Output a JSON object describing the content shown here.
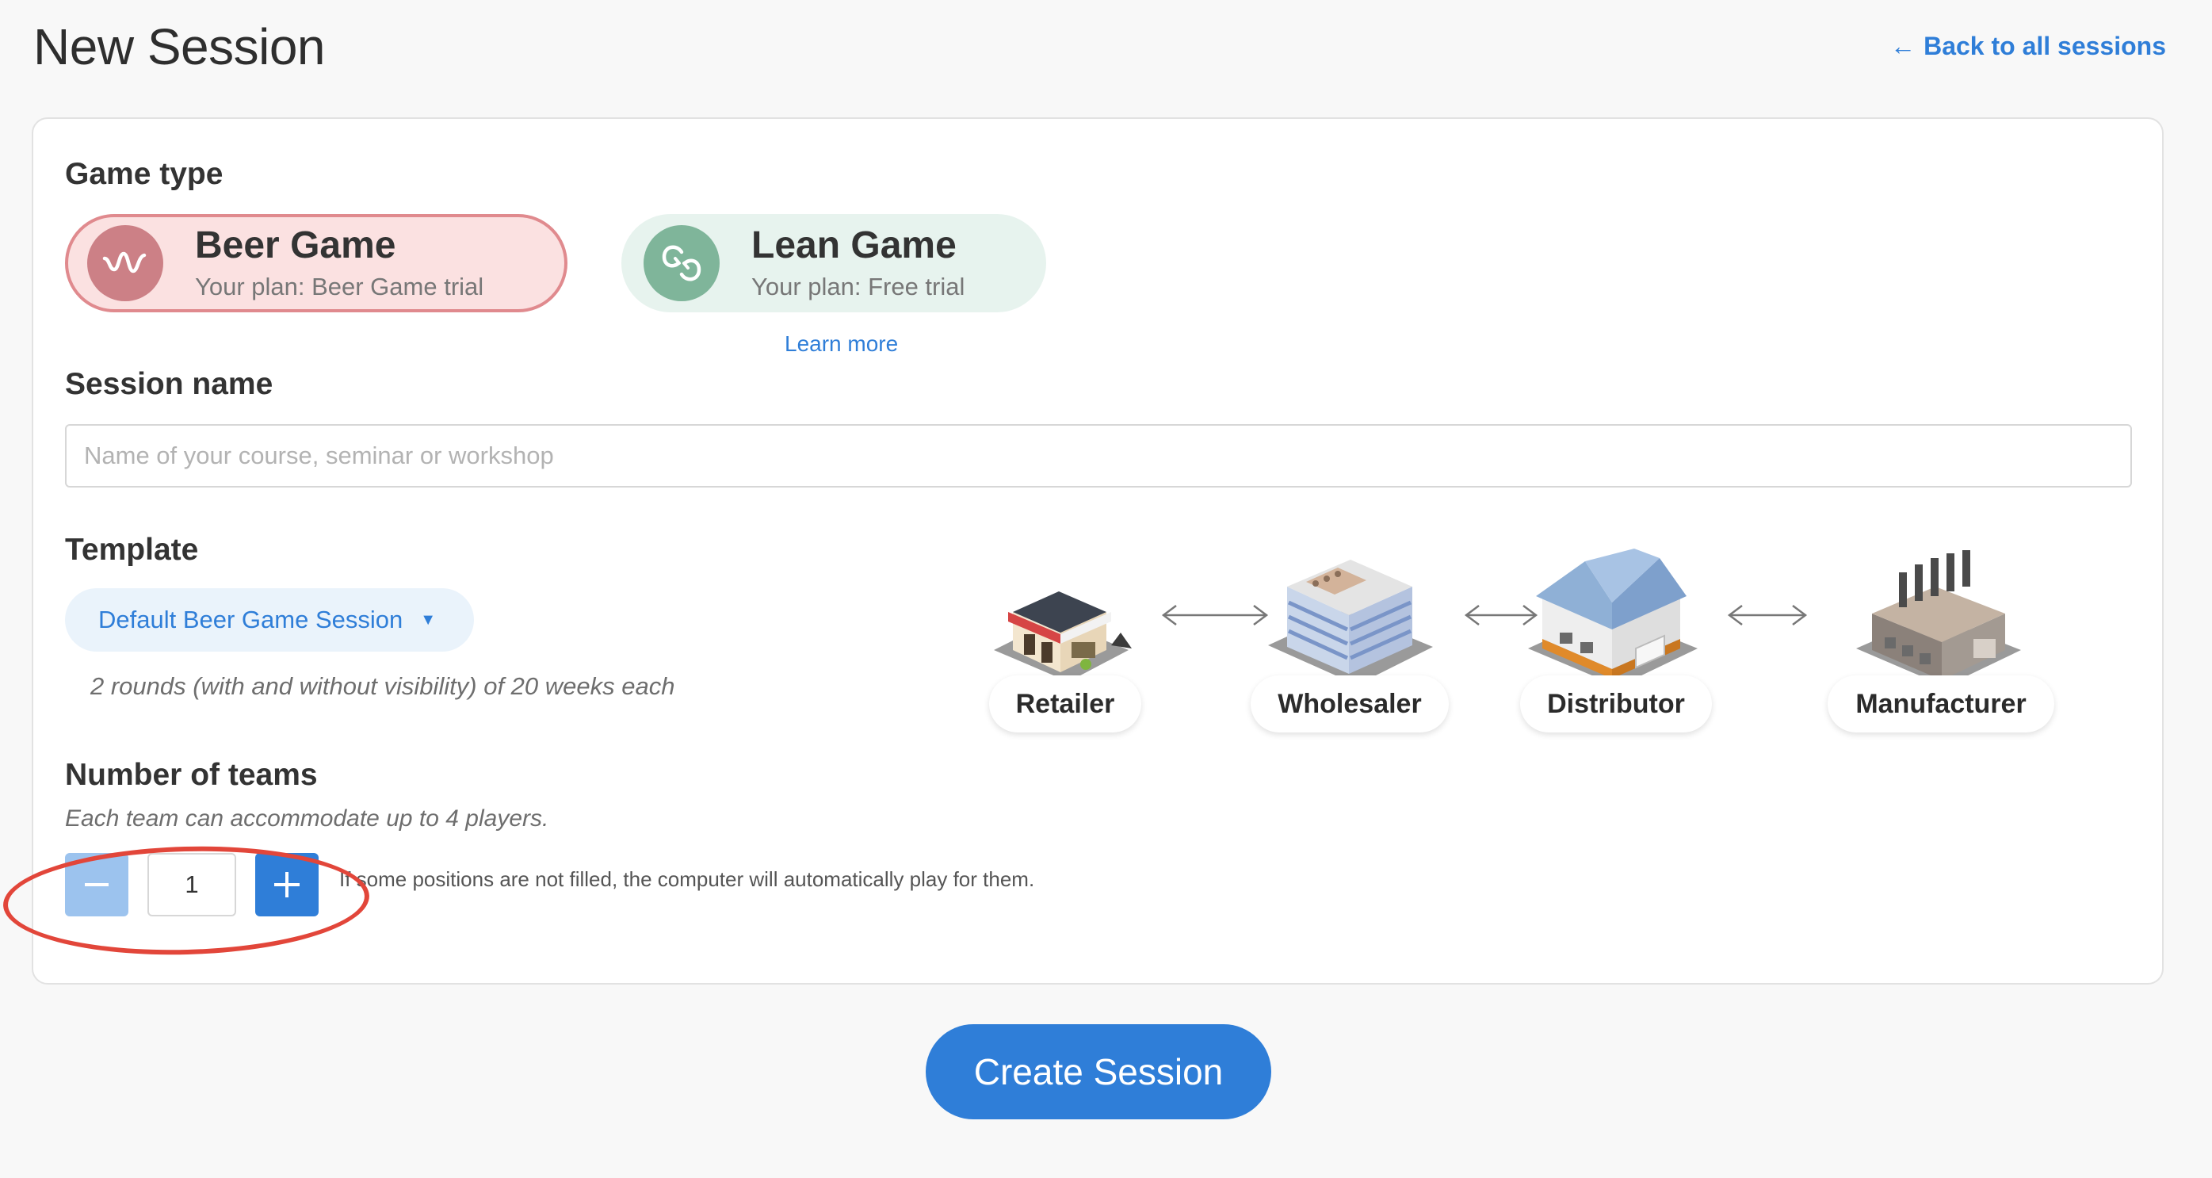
{
  "header": {
    "title": "New Session",
    "back_link": "Back to all sessions",
    "back_arrow": "←"
  },
  "game_type": {
    "label": "Game type",
    "options": [
      {
        "name": "Beer Game",
        "plan": "Your plan: Beer Game trial",
        "selected": true,
        "icon": "wave-icon",
        "color": "#cc8086"
      },
      {
        "name": "Lean Game",
        "plan": "Your plan: Free trial",
        "selected": false,
        "icon": "cycle-arrows-icon",
        "color": "#7fb59a"
      }
    ],
    "learn_more": "Learn more"
  },
  "session_name": {
    "label": "Session name",
    "placeholder": "Name of your course, seminar or workshop",
    "value": ""
  },
  "template": {
    "label": "Template",
    "selected": "Default Beer Game Session",
    "description": "2 rounds (with and without visibility) of 20 weeks each"
  },
  "supply_chain": {
    "roles": [
      "Retailer",
      "Wholesaler",
      "Distributor",
      "Manufacturer"
    ]
  },
  "teams": {
    "label": "Number of teams",
    "subtitle": "Each team can accommodate up to 4 players.",
    "count": "1",
    "minus": "−",
    "plus": "+",
    "note": "If some positions are not filled, the computer will automatically play for them."
  },
  "actions": {
    "create": "Create Session"
  },
  "colors": {
    "accent": "#2f7ed8",
    "annotation": "#e2463a"
  }
}
